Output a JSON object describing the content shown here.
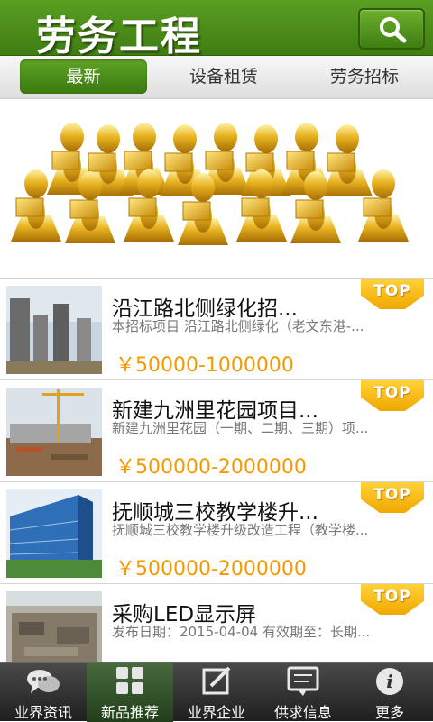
{
  "header": {
    "title": "劳务工程",
    "search_icon": "search-icon"
  },
  "tabs": [
    {
      "label": "最新",
      "active": true
    },
    {
      "label": "设备租赁",
      "active": false
    },
    {
      "label": "劳务招标",
      "active": false
    }
  ],
  "banner": {
    "image": "golden-figures-with-laptops-illustration"
  },
  "list": [
    {
      "title": "沿江路北侧绿化招...",
      "desc": "本招标项目 沿江路北侧绿化（老文东港-...",
      "price": "￥50000-1000000",
      "badge": "TOP",
      "thumb": "high-rise-construction-photo"
    },
    {
      "title": "新建九洲里花园项目...",
      "desc": "新建九洲里花园（一期、二期、三期）项...",
      "price": "￥500000-2000000",
      "badge": "TOP",
      "thumb": "construction-site-crane-photo"
    },
    {
      "title": "抚顺城三校教学楼升...",
      "desc": "抚顺城三校教学楼升级改造工程（教学楼...",
      "price": "￥500000-2000000",
      "badge": "TOP",
      "thumb": "glass-building-photo"
    },
    {
      "title": "采购LED显示屏",
      "desc": "发布日期：2015-04-04 有效期至：长期...",
      "price": "",
      "badge": "TOP",
      "thumb": "foundation-excavation-photo"
    }
  ],
  "bottom_nav": [
    {
      "label": "业界资讯",
      "icon": "chat-bubbles-icon",
      "active": false
    },
    {
      "label": "新品推荐",
      "icon": "grid-icon",
      "active": true
    },
    {
      "label": "业界企业",
      "icon": "edit-icon",
      "active": false
    },
    {
      "label": "供求信息",
      "icon": "message-icon",
      "active": false
    },
    {
      "label": "更多",
      "icon": "info-icon",
      "active": false
    }
  ]
}
